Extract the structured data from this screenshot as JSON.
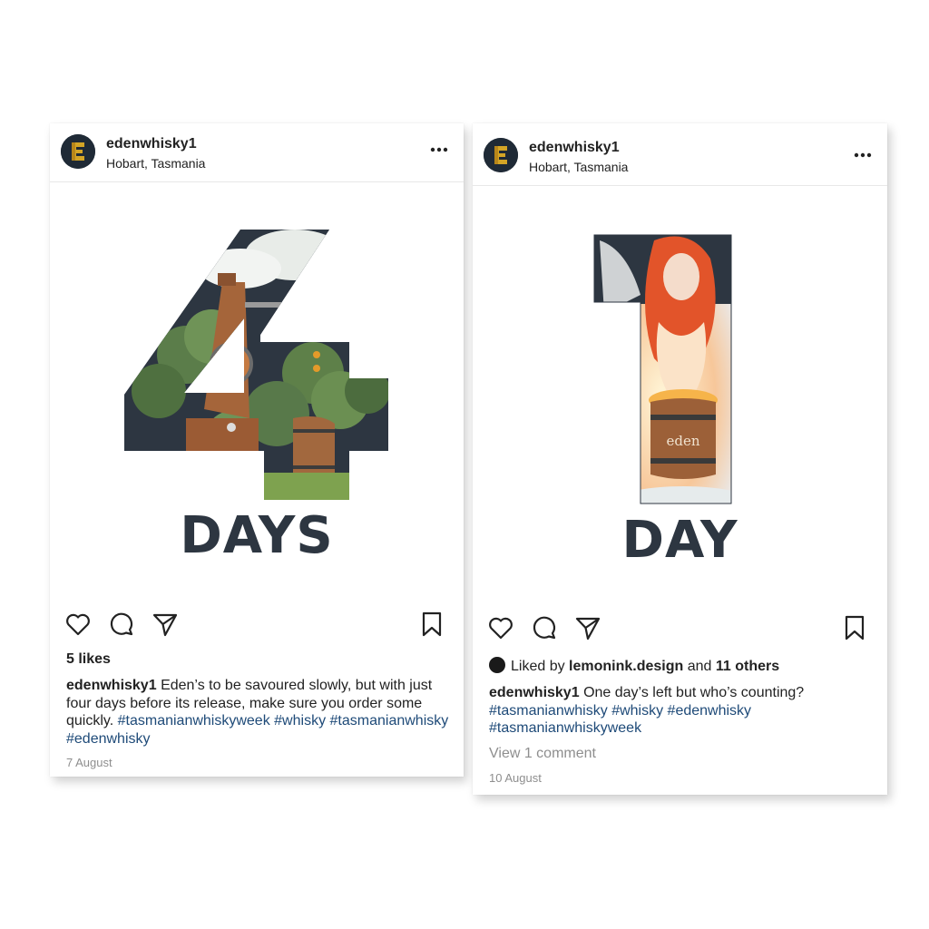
{
  "posts": [
    {
      "username": "edenwhisky1",
      "location": "Hobart, Tasmania",
      "media_label": "DAYS",
      "likes": "5 likes",
      "caption_text": "Eden’s to be savoured slowly, but with just four days before its release, make sure you order some quickly.",
      "hashtags": [
        "#tasmanianwhiskyweek",
        "#whisky",
        "#tasmanianwhisky",
        "#edenwhisky"
      ],
      "date": "7 August"
    },
    {
      "username": "edenwhisky1",
      "location": "Hobart, Tasmania",
      "media_label": "DAY",
      "liked_by_prefix": "Liked by",
      "liked_by_user": "lemonink.design",
      "liked_by_joiner": "and",
      "liked_by_others": "11 others",
      "caption_text": "One day’s left but who’s counting?",
      "hashtags": [
        "#tasmanianwhisky",
        "#whisky",
        "#edenwhisky",
        "#tasmanianwhiskyweek"
      ],
      "view_comments": "View 1 comment",
      "barrel_label": "eden",
      "date": "10 August"
    }
  ],
  "colors": {
    "brand_navy": "#2d3641",
    "hashtag": "#1e4a78",
    "logo_gold": "#d4a526",
    "muted": "#8e8e8e"
  },
  "icons": [
    "eden-logo-icon",
    "more-icon",
    "heart-icon",
    "comment-icon",
    "share-icon",
    "bookmark-icon"
  ]
}
